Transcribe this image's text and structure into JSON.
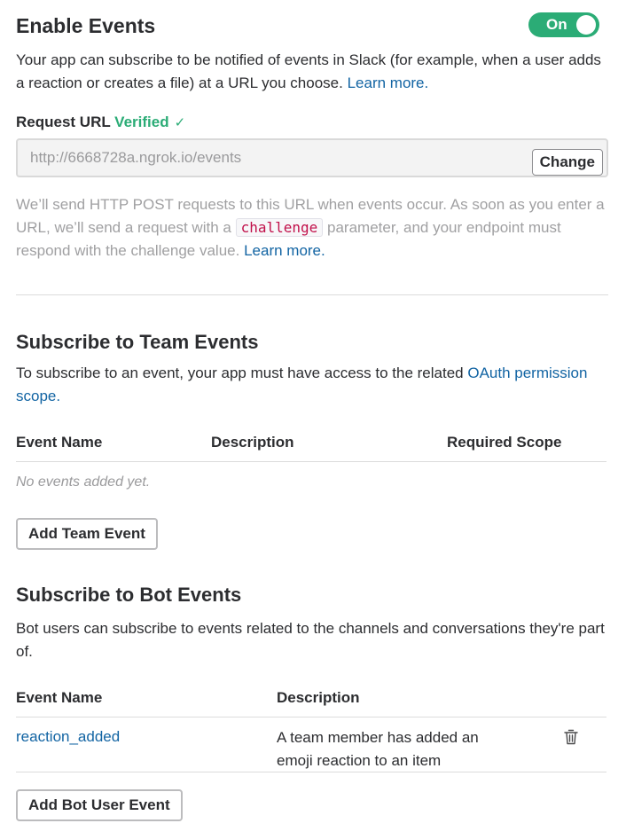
{
  "enable_events": {
    "title": "Enable Events",
    "toggle_label": "On",
    "toggle_color": "#2bac76",
    "description": "Your app can subscribe to be notified of events in Slack (for example, when a user adds a reaction or creates a file) at a URL you choose.",
    "learn_more": "Learn more."
  },
  "request_url": {
    "label": "Request URL",
    "status": "Verified",
    "status_icon": "checkmark-icon",
    "value": "http://6668728a.ngrok.io/events",
    "change_button": "Change",
    "help_part1": "We’ll send HTTP POST requests to this URL when events occur. As soon as you enter a URL, we’ll send a request with a",
    "help_code": "challenge",
    "help_part2": "parameter, and your endpoint must respond with the challenge value.",
    "learn_more": "Learn more."
  },
  "team_events": {
    "title": "Subscribe to Team Events",
    "description": "To subscribe to an event, your app must have access to the related",
    "scope_link": "OAuth permission scope.",
    "columns": [
      "Event Name",
      "Description",
      "Required Scope"
    ],
    "empty_text": "No events added yet.",
    "add_button": "Add Team Event"
  },
  "bot_events": {
    "title": "Subscribe to Bot Events",
    "description": "Bot users can subscribe to events related to the channels and conversations they're part of.",
    "columns": [
      "Event Name",
      "Description"
    ],
    "rows": [
      {
        "name": "reaction_added",
        "description": "A team member has added an emoji reaction to an item",
        "action_icon": "trash-icon"
      }
    ],
    "add_button": "Add Bot User Event"
  },
  "colors": {
    "link": "#1264a3",
    "verified": "#2bac76",
    "code": "#c1104a"
  }
}
